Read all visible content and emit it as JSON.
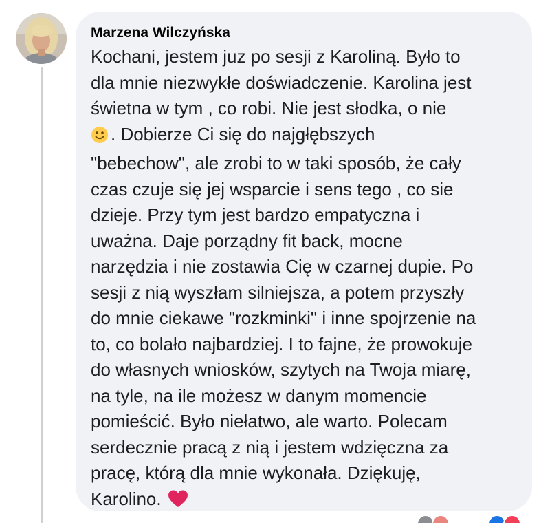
{
  "comment": {
    "author": "Marzena Wilczyńska",
    "text_lines": [
      "Kochani, jestem juz po sesji z Karoliną. Było to",
      "dla mnie niezwykłe doświadczenie. Karolina jest",
      "świetna w tym , co robi. Nie jest słodka, o nie",
      ". Dobierze Ci się do najgłębszych",
      "\"bebechow\", ale zrobi to w taki sposób, że cały",
      "czas czuje się jej wsparcie i sens tego , co sie",
      "dzieje. Przy tym jest bardzo empatyczna i",
      "uważna. Daje porządny fit back, mocne",
      "narzędzia i nie zostawia Cię w czarnej dupie. Po",
      "sesji z nią wyszłam silniejsza, a potem przyszły",
      "do mnie ciekawe \"rozkminki\" i inne spojrzenie na",
      "to, co bolało najbardziej. I to fajne, że prowokuje",
      "do własnych wniosków, szytych na Twoja miarę,",
      "na tyle, na ile możesz w danym momencie",
      "pomieścić. Było niełatwo, ale warto. Polecam",
      "serdecznie pracą z nią i jestem wdzięczna za",
      "pracę, którą dla mnie wykonała. Dziękuję,",
      "Karolino."
    ],
    "emojis": {
      "smile": "slightly-smiling-face-icon",
      "heart": "red-heart-icon"
    }
  },
  "colors": {
    "bubble_background": "#f0f2f5",
    "text": "#1c1e21",
    "thread_line": "#ced0d4",
    "heart": "#e0245e",
    "smile": "#ffcc4d"
  }
}
